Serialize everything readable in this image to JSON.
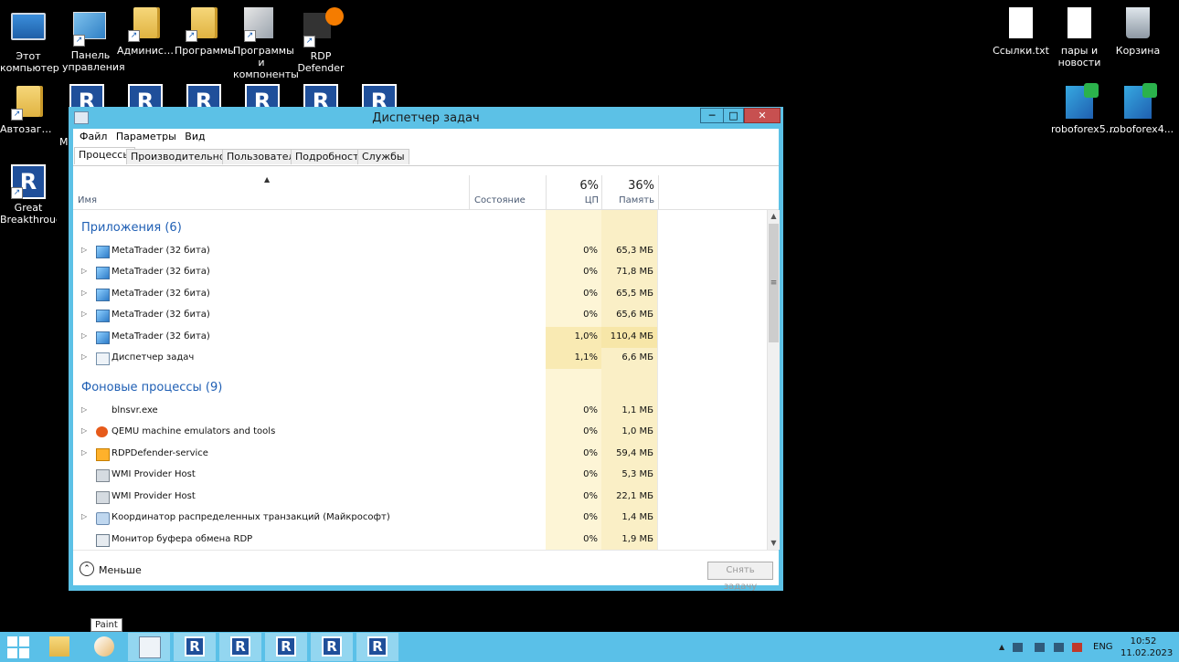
{
  "desktop": {
    "icons_left": [
      {
        "label": "Этот компьютер"
      },
      {
        "label": "Панель управления"
      },
      {
        "label": "Администрирование"
      },
      {
        "label": "Программы"
      },
      {
        "label": "Программы и компоненты"
      },
      {
        "label": "RDP Defender"
      }
    ],
    "icon_autoload": "Автозагрузка",
    "icon_partial_letter": "M",
    "icon_great": "Great Breakthrough",
    "icons_right": [
      {
        "label": "Ссылки.txt"
      },
      {
        "label": "пары и новости"
      },
      {
        "label": "Корзина"
      },
      {
        "label": "roboforex5..."
      },
      {
        "label": "roboforex4..."
      }
    ]
  },
  "window": {
    "title": "Диспетчер задач",
    "min_glyph": "─",
    "max_glyph": "□",
    "close_glyph": "✕",
    "menu": [
      "Файл",
      "Параметры",
      "Вид"
    ],
    "tabs": [
      "Процессы",
      "Производительность",
      "Пользователи",
      "Подробности",
      "Службы"
    ],
    "active_tab": "Процессы",
    "columns": {
      "name": "Имя",
      "state": "Состояние",
      "cpu_pct": "6%",
      "cpu": "ЦП",
      "mem_pct": "36%",
      "mem": "Память"
    },
    "sort_arrow": "▲",
    "groups": {
      "apps": "Приложения (6)",
      "background": "Фоновые процессы (9)"
    },
    "apps": [
      {
        "name": "MetaTrader (32 бита)",
        "cpu": "0%",
        "mem": "65,3 МБ"
      },
      {
        "name": "MetaTrader (32 бита)",
        "cpu": "0%",
        "mem": "71,8 МБ"
      },
      {
        "name": "MetaTrader (32 бита)",
        "cpu": "0%",
        "mem": "65,5 МБ"
      },
      {
        "name": "MetaTrader (32 бита)",
        "cpu": "0%",
        "mem": "65,6 МБ"
      },
      {
        "name": "MetaTrader (32 бита)",
        "cpu": "1,0%",
        "mem": "110,4 МБ"
      },
      {
        "name": "Диспетчер задач",
        "cpu": "1,1%",
        "mem": "6,6 МБ"
      }
    ],
    "background": [
      {
        "name": "blnsvr.exe",
        "cpu": "0%",
        "mem": "1,1 МБ"
      },
      {
        "name": "QEMU machine emulators and tools",
        "cpu": "0%",
        "mem": "1,0 МБ"
      },
      {
        "name": "RDPDefender-service",
        "cpu": "0%",
        "mem": "59,4 МБ"
      },
      {
        "name": "WMI Provider Host",
        "cpu": "0%",
        "mem": "5,3 МБ"
      },
      {
        "name": "WMI Provider Host",
        "cpu": "0%",
        "mem": "22,1 МБ"
      },
      {
        "name": "Координатор распределенных транзакций (Майкрософт)",
        "cpu": "0%",
        "mem": "1,4 МБ"
      },
      {
        "name": "Монитор буфера обмена RDP",
        "cpu": "0%",
        "mem": "1,9 МБ"
      }
    ],
    "less_label": "Меньше",
    "end_task_label": "Снять задачу"
  },
  "taskbar": {
    "tooltip": "Paint",
    "lang": "ENG",
    "time": "10:52",
    "date": "11.02.2023",
    "app_glyph": "R"
  }
}
